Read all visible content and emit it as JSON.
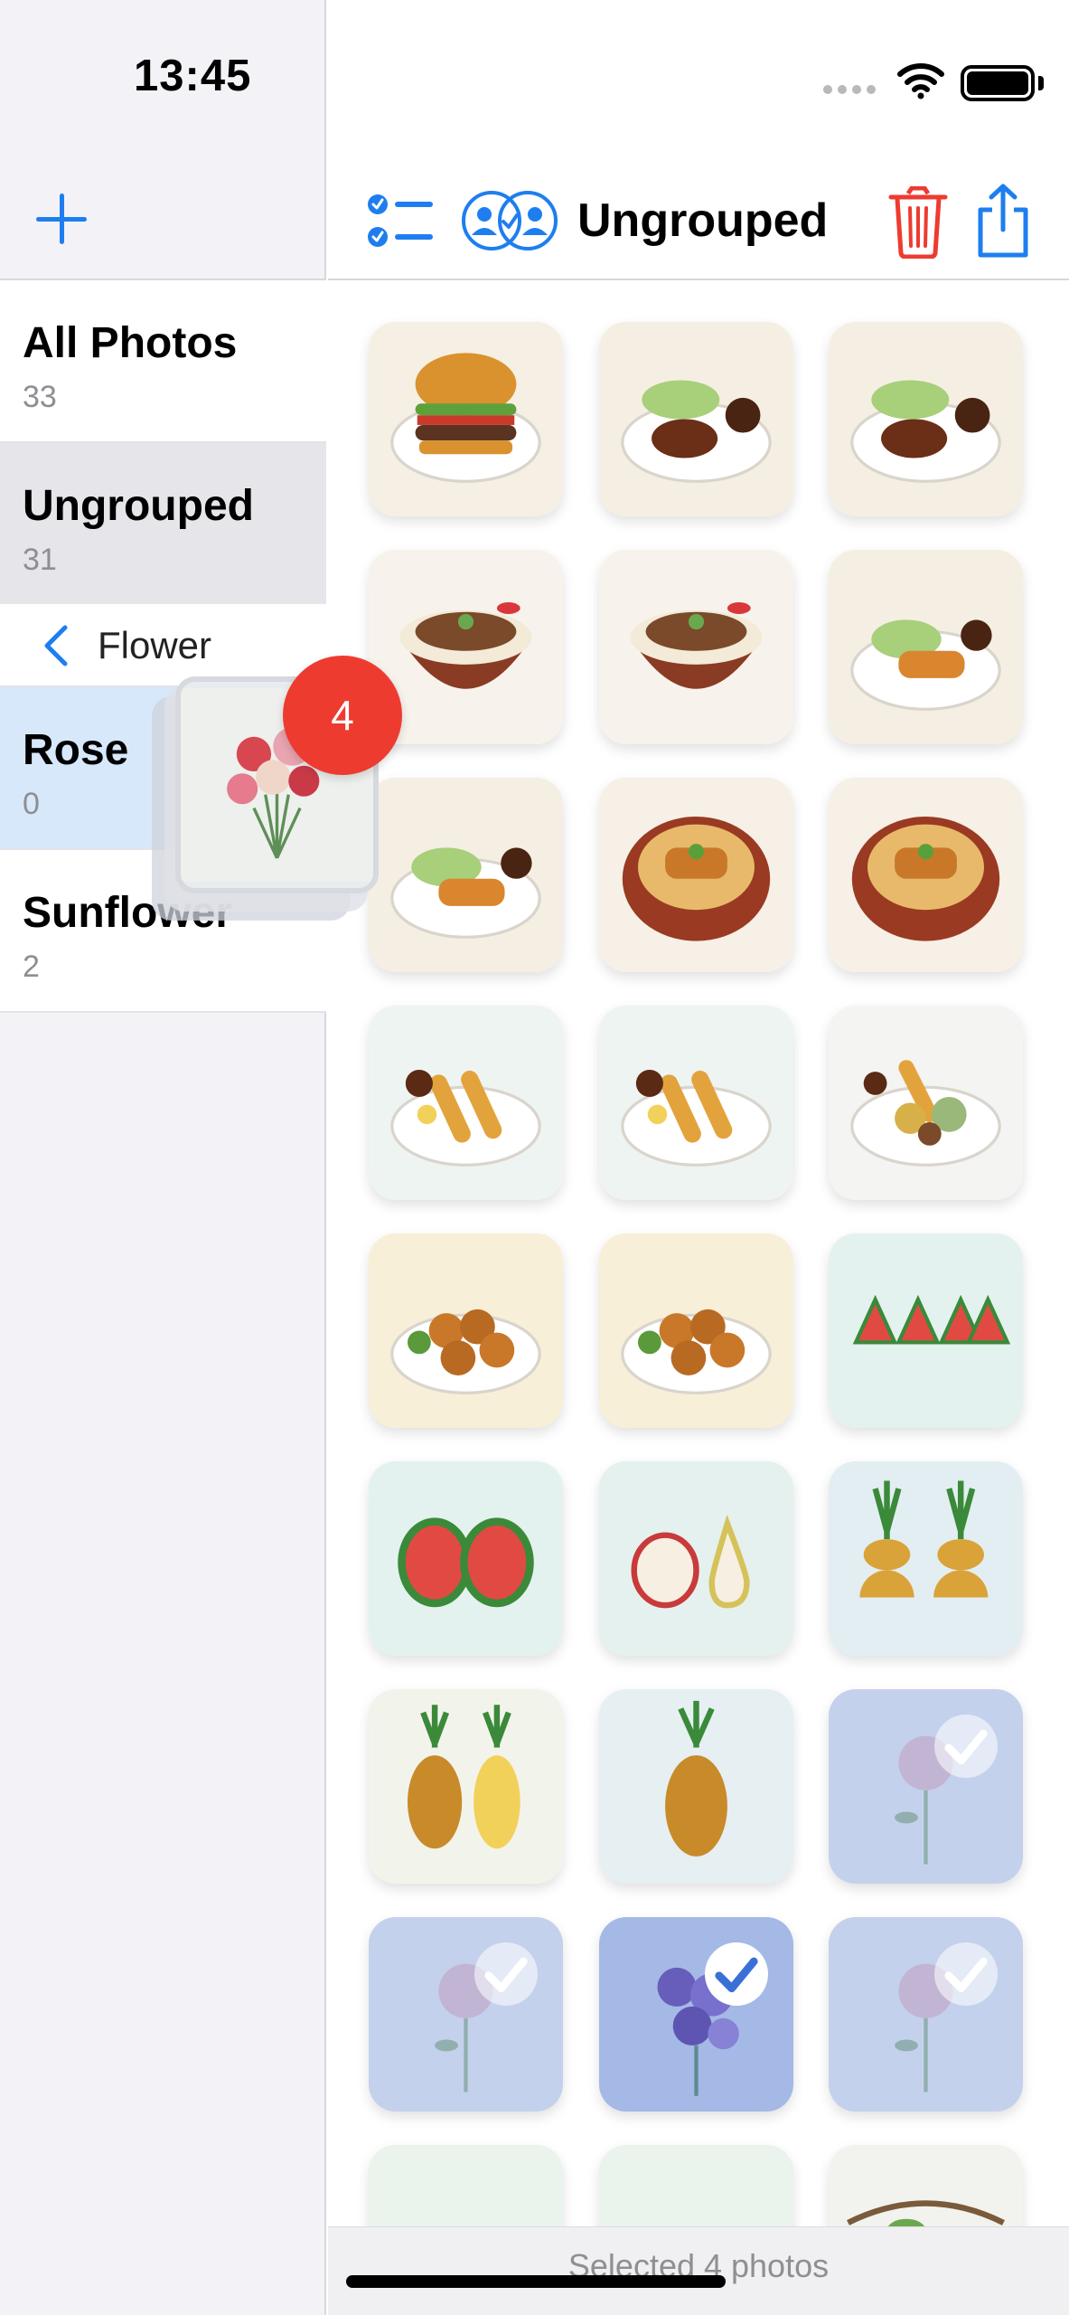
{
  "status": {
    "time": "13:45"
  },
  "sidebar": {
    "add_label": "",
    "groups": [
      {
        "name": "All Photos",
        "count": "33"
      },
      {
        "name": "Ungrouped",
        "count": "31"
      }
    ],
    "folder": {
      "label": "Flower"
    },
    "subgroups": [
      {
        "name": "Rose",
        "count": "0"
      },
      {
        "name": "Sunflower",
        "count": "2"
      }
    ]
  },
  "drag": {
    "badge_count": "4"
  },
  "toolbar": {
    "title": "Ungrouped"
  },
  "photos": [
    "hamburger",
    "hamburg-steak",
    "hamburg-steak",
    "gyudon",
    "gyudon",
    "tonkatsu-plate",
    "tonkatsu-plate",
    "katsudon",
    "katsudon",
    "fried-shrimp",
    "fried-shrimp",
    "tempura",
    "karaage",
    "karaage",
    "watermelon-slices",
    "watermelon-halves",
    "apple-pear",
    "pineapple-halves",
    "pineapple-pair",
    "pineapple-single",
    "rose-selected",
    "rose-selected",
    "rose-selected-active",
    "rose-selected",
    "leaves",
    "leaves",
    "grapes"
  ],
  "bottom": {
    "selection_text": "Selected 4 photos"
  },
  "colors": {
    "accent": "#1e7ef0",
    "destructive": "#ee3b30",
    "badge": "#ee3b30"
  }
}
